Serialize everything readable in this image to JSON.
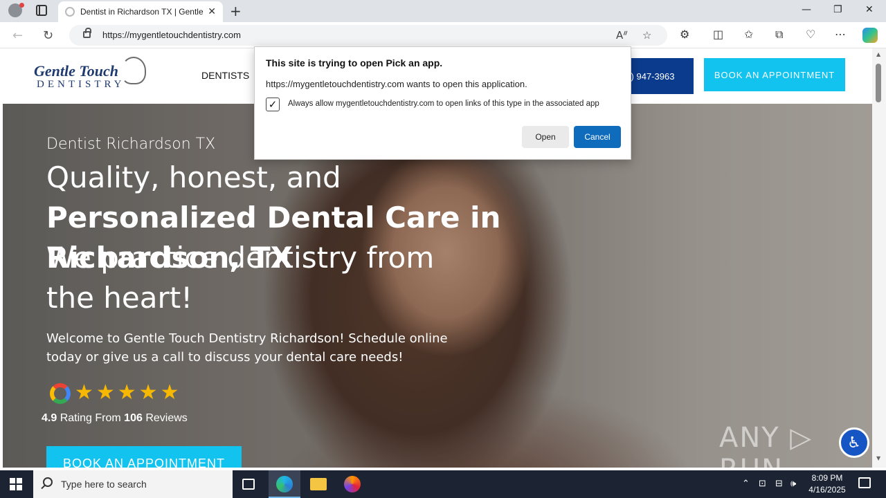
{
  "browser": {
    "tab_title": "Dentist in Richardson TX | Gentle",
    "url": "https://mygentletouchdentistry.com",
    "controls": {
      "minimize": "—",
      "maximize": "❐",
      "close": "✕"
    }
  },
  "site": {
    "logo_top": "Gentle Touch",
    "logo_bottom": "DENTISTRY",
    "nav_dentists": "DENTISTS",
    "phone": ") 947-3963",
    "book_top": "BOOK AN APPOINTMENT"
  },
  "hero": {
    "subtitle": "Dentist Richardson TX",
    "h1_light": "Quality, honest, and ",
    "h1_bold": "Personalized Dental Care in Richardson, TX",
    "h2": "We practice dentistry from the heart!",
    "welcome": "Welcome to Gentle Touch Dentistry Richardson! Schedule online today or give us a call to discuss your dental care needs!",
    "stars": "★★★★★",
    "rating_value": "4.9",
    "rating_mid": " Rating From ",
    "rating_count": "106",
    "rating_end": " Reviews",
    "book_cta": "BOOK AN APPOINTMENT",
    "watermark": "ANY ▷ RUN"
  },
  "dialog": {
    "title": "This site is trying to open Pick an app.",
    "message": "https://mygentletouchdentistry.com wants to open this application.",
    "checkbox_label": "Always allow mygentletouchdentistry.com to open links of this type in the associated app",
    "checkbox_checked": true,
    "open_label": "Open",
    "cancel_label": "Cancel"
  },
  "taskbar": {
    "search_placeholder": "Type here to search",
    "time": "8:09 PM",
    "date": "4/16/2025"
  }
}
